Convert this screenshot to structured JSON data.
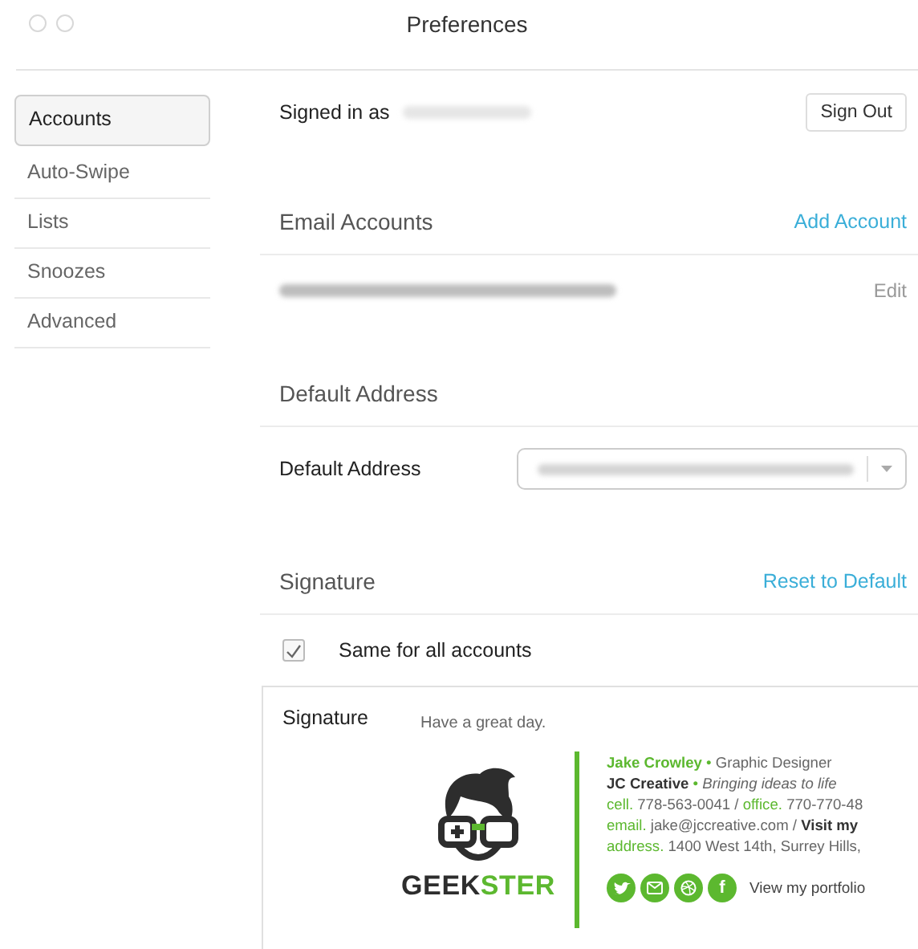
{
  "window": {
    "title": "Preferences"
  },
  "sidebar": {
    "items": [
      {
        "label": "Accounts",
        "selected": true
      },
      {
        "label": "Auto-Swipe",
        "selected": false
      },
      {
        "label": "Lists",
        "selected": false
      },
      {
        "label": "Snoozes",
        "selected": false
      },
      {
        "label": "Advanced",
        "selected": false
      }
    ]
  },
  "account": {
    "label": "Signed in as",
    "button": "Sign Out"
  },
  "email_accounts": {
    "heading": "Email Accounts",
    "action": "Add Account",
    "rows": [
      {
        "action": "Edit"
      }
    ]
  },
  "default_address": {
    "heading": "Default Address",
    "label": "Default Address"
  },
  "signature": {
    "heading": "Signature",
    "action": "Reset to Default",
    "same_for_all": {
      "label": "Same for all accounts",
      "checked": true
    },
    "editor": {
      "label": "Signature",
      "greeting": "Have a great day.",
      "logo": [
        {
          "text": "GEEK",
          "accent": false
        },
        {
          "text": "STER",
          "accent": true
        }
      ],
      "lines": [
        [
          {
            "kind": "name",
            "text": "Jake Crowley"
          },
          {
            "kind": "dot",
            "text": "•"
          },
          {
            "kind": "plain",
            "text": "Graphic Designer"
          }
        ],
        [
          {
            "kind": "strong",
            "text": "JC Creative"
          },
          {
            "kind": "dot",
            "text": "•"
          },
          {
            "kind": "italic",
            "text": "Bringing ideas to life"
          }
        ],
        [
          {
            "kind": "label",
            "text": "cell."
          },
          {
            "kind": "plain",
            "text": "778-563-0041"
          },
          {
            "kind": "plain",
            "text": "/"
          },
          {
            "kind": "label",
            "text": "office."
          },
          {
            "kind": "plain",
            "text": "770-770-48"
          }
        ],
        [
          {
            "kind": "label",
            "text": "email."
          },
          {
            "kind": "plain",
            "text": "jake@jccreative.com"
          },
          {
            "kind": "plain",
            "text": "/"
          },
          {
            "kind": "strong",
            "text": "Visit my"
          }
        ],
        [
          {
            "kind": "label",
            "text": "address."
          },
          {
            "kind": "plain",
            "text": "1400 West 14th, Surrey Hills,"
          }
        ]
      ],
      "social": [
        {
          "kind": "bird"
        },
        {
          "kind": "mail"
        },
        {
          "kind": "ball"
        },
        {
          "kind": "letter",
          "text": "f"
        }
      ],
      "portfolio": "View my portfolio"
    }
  }
}
